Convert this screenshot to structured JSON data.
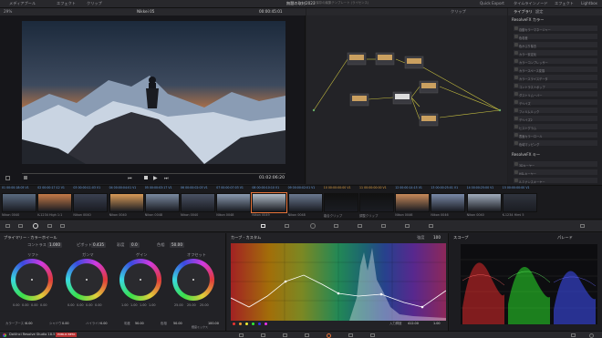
{
  "topbar": {
    "left_items": [
      "メディアプール",
      "エフェクト",
      "クリップ"
    ],
    "project_title": "無題の取材2023",
    "project_sub": "未保存の編集テンプレート (ライセンス)",
    "right_items": [
      "Quick Export",
      "タイムライン",
      "ノード",
      "エフェクト",
      "Lightbox"
    ]
  },
  "viewer": {
    "left_label": "29%",
    "clip_name": "Nikkei 05",
    "timecode_top": "00:00:45:01",
    "timecode_bottom": "01:02:06:20"
  },
  "nodes": {
    "label": "クリップ"
  },
  "library": {
    "tab1": "ライブラリ",
    "tab2": "設定",
    "section_title": "ResolveFX カラー",
    "section_title_2": "ResolveFX キー",
    "items": [
      "自動カラーマネージャー",
      "色収差",
      "色かぶり除去",
      "カラー安定化",
      "カラーコンプレッサー",
      "カラースペース変換",
      "カラースライスデータ",
      "コントラストポップ",
      "ダストリムーバー",
      "デヘイズ",
      "フィルムルック",
      "デヘイズ2",
      "ヒストグラム",
      "表面カラーロール",
      "色域マッピング"
    ],
    "items_key": [
      "3Dキーヤー",
      "HSLキーヤー",
      "ルミナンスキーヤー"
    ]
  },
  "timeline": {
    "clips": [
      {
        "num": "01",
        "tc": "00:00:18:05",
        "name": "Nikon 0040",
        "v": "V1"
      },
      {
        "num": "02",
        "tc": "00:00:17:12",
        "name": "K-1234 High 1:1",
        "v": "V1"
      },
      {
        "num": "03",
        "tc": "00:00:11:03",
        "name": "Nikon 0040",
        "v": "V1"
      },
      {
        "num": "04",
        "tc": "00:00:04:01",
        "name": "Nikon 0040",
        "v": "V1"
      },
      {
        "num": "05",
        "tc": "00:00:03:17",
        "name": "Nikon 0048",
        "v": "V1"
      },
      {
        "num": "06",
        "tc": "00:00:02:03",
        "name": "Nikon 0040",
        "v": "V1"
      },
      {
        "num": "07",
        "tc": "00:00:07:03",
        "name": "Nikon 0048",
        "v": "V1"
      },
      {
        "num": "08",
        "tc": "00:00:10:10",
        "name": "Nikon 0049",
        "v": "V1"
      },
      {
        "num": "09",
        "tc": "00:00:02:01",
        "name": "Nikon 0048",
        "v": "V1"
      },
      {
        "num": "10",
        "tc": "00:00:00:00",
        "name": "複合クリップ",
        "v": "V1"
      },
      {
        "num": "11",
        "tc": "00:00:00:00",
        "name": "調整クリップ",
        "v": "V1"
      },
      {
        "num": "12",
        "tc": "00:00:14:15",
        "name": "Nikon 0046",
        "v": "V1"
      },
      {
        "num": "13",
        "tc": "00:00:25:01",
        "name": "Nikon 0046",
        "v": "V1"
      },
      {
        "num": "14",
        "tc": "00:00:25:00",
        "name": "Nikon 0040",
        "v": "V1"
      },
      {
        "num": "15",
        "tc": "00:00:00:00",
        "name": "K-1234 Himi 5",
        "v": "V1"
      }
    ]
  },
  "wheels": {
    "title": "プライマリー - カラーホイール",
    "top_params": [
      {
        "l": "コントラスト",
        "v": "1.000"
      },
      {
        "l": "ピボット",
        "v": "0.435"
      },
      {
        "l": "彩度",
        "v": "0.0"
      },
      {
        "l": "色相",
        "v": "50.00"
      }
    ],
    "items": [
      {
        "name": "リフト",
        "vals": [
          "0.00",
          "0.00",
          "0.00",
          "0.00"
        ]
      },
      {
        "name": "ガンマ",
        "vals": [
          "0.00",
          "0.00",
          "0.00",
          "0.00"
        ]
      },
      {
        "name": "ゲイン",
        "vals": [
          "1.00",
          "1.00",
          "1.00",
          "1.00"
        ]
      },
      {
        "name": "オフセット",
        "vals": [
          "25.00",
          "25.00",
          "25.00"
        ]
      }
    ],
    "bottom_params": [
      {
        "l": "カラーブースト",
        "v": "0.00"
      },
      {
        "l": "シャドウ",
        "v": "0.00"
      },
      {
        "l": "ハイライト",
        "v": "0.00"
      },
      {
        "l": "彩度",
        "v": "50.00"
      },
      {
        "l": "色相",
        "v": "50.00"
      },
      {
        "l": "輝度ミックス",
        "v": "100.00"
      }
    ]
  },
  "curves": {
    "title": "カーブ - カスタム",
    "intensity_label": "強度",
    "intensity_value": "100",
    "bottom_label": "入力輝度",
    "bottom_value": "412.00",
    "bottom_value2": "1.00"
  },
  "scope": {
    "title": "スコープ",
    "mode": "パレード"
  },
  "status": {
    "app": "DaVinci Resolve Studio 18.5",
    "badge": "PUBLIC BETA"
  },
  "colors": {
    "accent": "#e8743a",
    "panel": "#28282c"
  }
}
